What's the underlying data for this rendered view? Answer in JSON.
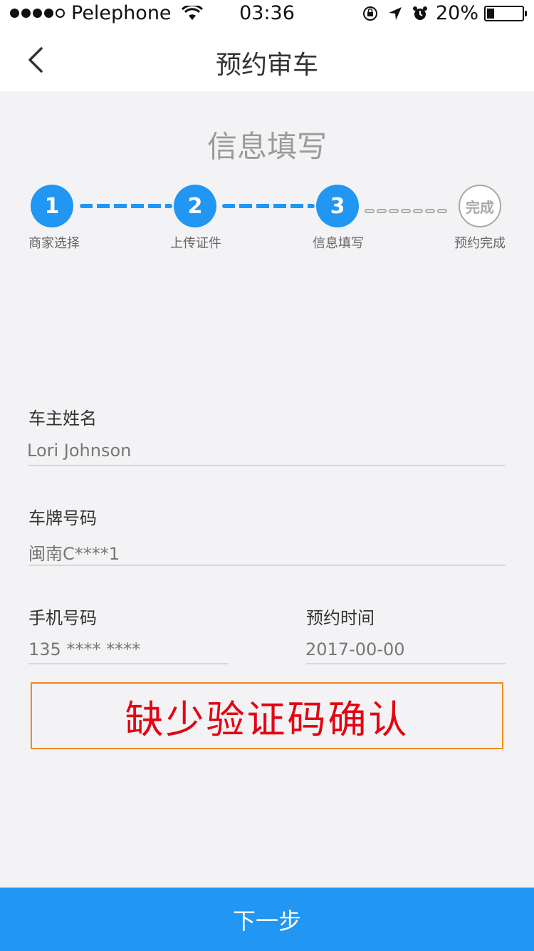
{
  "status_bar": {
    "carrier": "Pelephone",
    "time": "03:36",
    "battery": "20%",
    "battery_level": 0.2,
    "signal_icon": "signal-dots-icon",
    "wifi_icon": "wifi-icon",
    "lock_icon": "rotation-lock-icon",
    "location_icon": "location-arrow-icon",
    "alarm_icon": "alarm-clock-icon"
  },
  "nav": {
    "title": "预约审车",
    "back_icon": "chevron-left-icon"
  },
  "section_title": "信息填写",
  "steps": [
    {
      "number": "1",
      "label": "商家选择"
    },
    {
      "number": "2",
      "label": "上传证件"
    },
    {
      "number": "3",
      "label": "信息填写"
    },
    {
      "number": "完成",
      "label": "预约完成"
    }
  ],
  "form": {
    "owner_name": {
      "label": "车主姓名",
      "value": "Lori Johnson"
    },
    "plate": {
      "label": "车牌号码",
      "value": "闽南C****1"
    },
    "phone": {
      "label": "手机号码",
      "value": "135 **** ****"
    },
    "booking_time": {
      "label": "预约时间",
      "value": "2017-00-00"
    }
  },
  "notice": "缺少验证码确认",
  "next_button": "下一步",
  "colors": {
    "accent": "#2196F3",
    "notice_text": "#e60012",
    "notice_border": "#f08a1e"
  }
}
